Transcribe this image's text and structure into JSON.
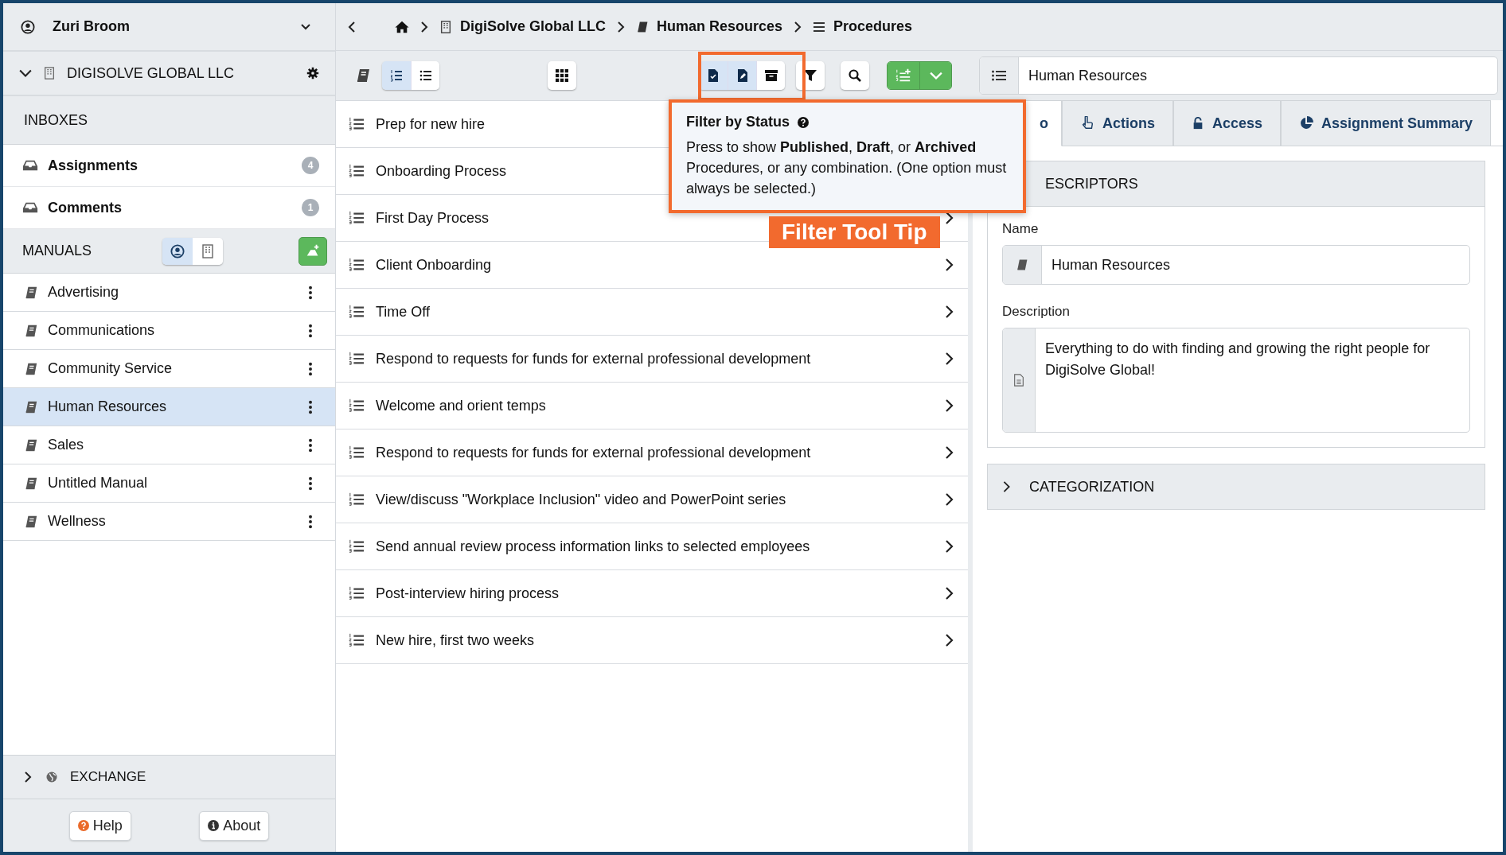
{
  "user": {
    "name": "Zuri Broom"
  },
  "org": {
    "name": "DIGISOLVE GLOBAL LLC"
  },
  "inboxes": {
    "title": "INBOXES",
    "items": [
      {
        "label": "Assignments",
        "count": "4"
      },
      {
        "label": "Comments",
        "count": "1"
      }
    ]
  },
  "manuals": {
    "title": "MANUALS",
    "scopes": [
      {
        "kind": "person",
        "selected": true
      },
      {
        "kind": "building",
        "selected": false
      }
    ],
    "items": [
      {
        "label": "Advertising",
        "selected": false
      },
      {
        "label": "Communications",
        "selected": false
      },
      {
        "label": "Community Service",
        "selected": false
      },
      {
        "label": "Human Resources",
        "selected": true
      },
      {
        "label": "Sales",
        "selected": false
      },
      {
        "label": "Untitled Manual",
        "selected": false
      },
      {
        "label": "Wellness",
        "selected": false
      }
    ]
  },
  "exchange": {
    "label": "EXCHANGE",
    "expanded": false
  },
  "footer_buttons": [
    {
      "kind": "help",
      "label": "Help"
    },
    {
      "kind": "about",
      "label": "About"
    }
  ],
  "breadcrumb": [
    {
      "kind": "home"
    },
    {
      "kind": "building",
      "label": "DigiSolve Global LLC"
    },
    {
      "kind": "book",
      "label": "Human Resources"
    },
    {
      "kind": "list",
      "label": "Procedures"
    }
  ],
  "toolbar": {
    "view_modes": [
      {
        "kind": "numbered",
        "selected": true
      },
      {
        "kind": "bullet",
        "selected": false
      }
    ],
    "status_filters": [
      {
        "kind": "published",
        "selected": true
      },
      {
        "kind": "draft",
        "selected": true
      },
      {
        "kind": "archived",
        "selected": false
      }
    ]
  },
  "procedures": [
    {
      "title": "Prep for new hire"
    },
    {
      "title": "Onboarding Process"
    },
    {
      "title": "First Day Process"
    },
    {
      "title": "Client Onboarding"
    },
    {
      "title": "Time Off"
    },
    {
      "title": "Respond to requests for funds for external professional development"
    },
    {
      "title": "Welcome and orient temps"
    },
    {
      "title": "Respond to requests for funds for external professional development"
    },
    {
      "title": "View/discuss \"Workplace Inclusion\" video and PowerPoint series"
    },
    {
      "title": "Send annual review process information links to selected employees"
    },
    {
      "title": "Post-interview hiring process"
    },
    {
      "title": "New hire, first two weeks"
    }
  ],
  "tooltip": {
    "title": "Filter by Status",
    "body": "Press to show **Published**, **Draft**, or **Archived** Procedures, or any combination. (One option must always be selected.)"
  },
  "callout": {
    "label": "Filter Tool Tip"
  },
  "detail": {
    "header": "Human Resources",
    "tabs": [
      {
        "kind": "info",
        "label": "o",
        "selected": true
      },
      {
        "kind": "actions",
        "label": "Actions",
        "selected": false
      },
      {
        "kind": "access",
        "label": "Access",
        "selected": false
      },
      {
        "kind": "summary",
        "label": "Assignment Summary",
        "selected": false
      }
    ],
    "descriptors": {
      "title": "ESCRIPTORS",
      "name_label": "Name",
      "name_value": "Human Resources",
      "description_label": "Description",
      "description_value": "Everything to do with finding and growing the right people for DigiSolve Global!"
    },
    "categorization": {
      "title": "CATEGORIZATION",
      "expanded": false
    }
  }
}
